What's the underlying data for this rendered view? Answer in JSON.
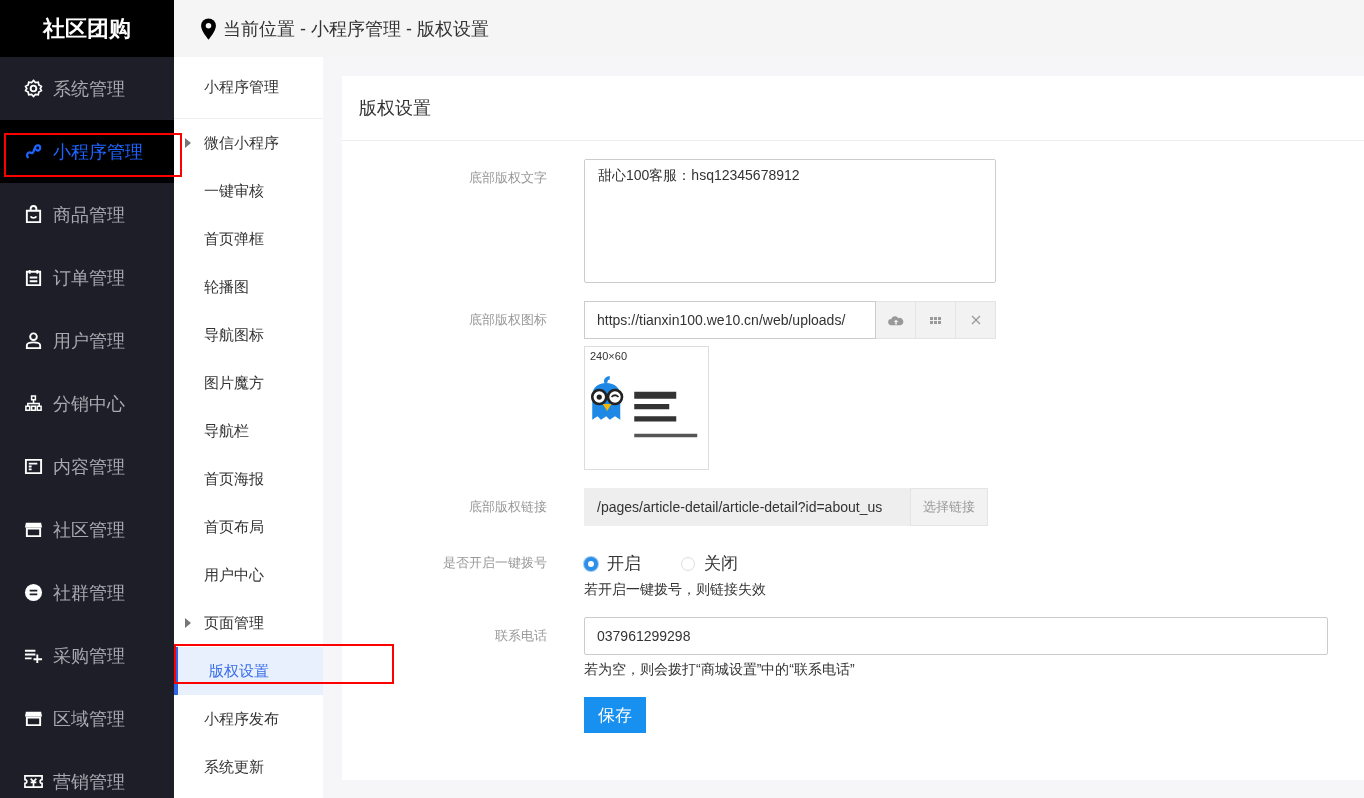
{
  "brand": "社区团购",
  "nav": [
    {
      "label": "系统管理",
      "kind": "gear",
      "selected": false,
      "highlighted": false
    },
    {
      "label": "小程序管理",
      "kind": "link",
      "selected": true,
      "highlighted": true
    },
    {
      "label": "商品管理",
      "kind": "bag",
      "selected": false,
      "highlighted": false
    },
    {
      "label": "订单管理",
      "kind": "calendar",
      "selected": false,
      "highlighted": false
    },
    {
      "label": "用户管理",
      "kind": "user",
      "selected": false,
      "highlighted": false
    },
    {
      "label": "分销中心",
      "kind": "org",
      "selected": false,
      "highlighted": false
    },
    {
      "label": "内容管理",
      "kind": "doc",
      "selected": false,
      "highlighted": false
    },
    {
      "label": "社区管理",
      "kind": "shop",
      "selected": false,
      "highlighted": false
    },
    {
      "label": "社群管理",
      "kind": "minus",
      "selected": false,
      "highlighted": false
    },
    {
      "label": "采购管理",
      "kind": "listplus",
      "selected": false,
      "highlighted": false
    },
    {
      "label": "区域管理",
      "kind": "shop",
      "selected": false,
      "highlighted": false
    },
    {
      "label": "营销管理",
      "kind": "ticket",
      "selected": false,
      "highlighted": false
    }
  ],
  "breadcrumb": "当前位置 - 小程序管理 - 版权设置",
  "subnav": {
    "title": "小程序管理",
    "items": [
      {
        "label": "微信小程序",
        "kind": "group",
        "expanded": false,
        "selected": false,
        "highlighted": false
      },
      {
        "label": "一键审核",
        "kind": "page",
        "selected": false,
        "highlighted": false
      },
      {
        "label": "首页弹框",
        "kind": "page",
        "selected": false,
        "highlighted": false
      },
      {
        "label": "轮播图",
        "kind": "page",
        "selected": false,
        "highlighted": false
      },
      {
        "label": "导航图标",
        "kind": "page",
        "selected": false,
        "highlighted": false
      },
      {
        "label": "图片魔方",
        "kind": "page",
        "selected": false,
        "highlighted": false
      },
      {
        "label": "导航栏",
        "kind": "page",
        "selected": false,
        "highlighted": false
      },
      {
        "label": "首页海报",
        "kind": "page",
        "selected": false,
        "highlighted": false
      },
      {
        "label": "首页布局",
        "kind": "page",
        "selected": false,
        "highlighted": false
      },
      {
        "label": "用户中心",
        "kind": "page",
        "selected": false,
        "highlighted": false
      },
      {
        "label": "页面管理",
        "kind": "group",
        "expanded": false,
        "selected": false,
        "highlighted": false
      },
      {
        "label": "版权设置",
        "kind": "page",
        "selected": true,
        "highlighted": true
      },
      {
        "label": "小程序发布",
        "kind": "page",
        "selected": false,
        "highlighted": false
      },
      {
        "label": "系统更新",
        "kind": "page",
        "selected": false,
        "highlighted": false
      }
    ]
  },
  "panel": {
    "title": "版权设置",
    "fields": [
      {
        "kind": "textarea",
        "label": "底部版权文字",
        "value": "甜心100客服：hsq12345678912"
      },
      {
        "kind": "image",
        "label": "底部版权图标",
        "value": "https://tianxin100.we10.cn/web/uploads/",
        "size_hint": "240×60"
      },
      {
        "kind": "link",
        "label": "底部版权链接",
        "value": "/pages/article-detail/article-detail?id=about_us",
        "button": "选择链接"
      },
      {
        "kind": "radio",
        "label": "是否开启一键拨号",
        "options": [
          {
            "label": "开启",
            "selected": true
          },
          {
            "label": "关闭",
            "selected": false
          }
        ],
        "hint": "若开启一键拨号，则链接失效"
      },
      {
        "kind": "text",
        "label": "联系电话",
        "value": "037961299298",
        "hint": "若为空，则会拨打“商城设置”中的“联系电话”"
      }
    ],
    "save": "保存"
  }
}
